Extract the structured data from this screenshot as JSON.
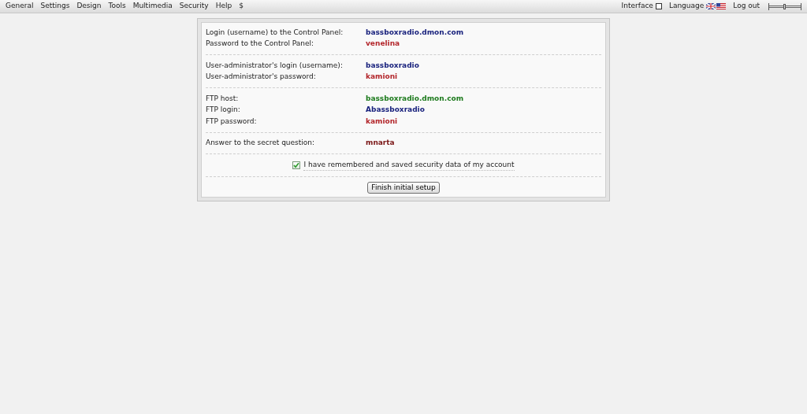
{
  "menu": [
    {
      "label": "General"
    },
    {
      "label": "Settings"
    },
    {
      "label": "Design"
    },
    {
      "label": "Tools"
    },
    {
      "label": "Multimedia"
    },
    {
      "label": "Security"
    },
    {
      "label": "Help"
    },
    {
      "label": "$"
    }
  ],
  "toolbar": {
    "interface": {
      "label": "Interface",
      "checked": false
    },
    "language": {
      "label": "Language"
    },
    "logout": {
      "label": "Log out"
    },
    "size_slider": {
      "level": 0.5
    }
  },
  "groups": [
    {
      "rows": [
        {
          "label": "Login (username) to the Control Panel:",
          "value": "bassboxradio.dmon.com",
          "color": "#1a237e"
        },
        {
          "label": "Password to the Control Panel:",
          "value": "venelina",
          "color": "#b3262b"
        }
      ]
    },
    {
      "rows": [
        {
          "label": "User-administrator's login (username):",
          "value": "bassboxradio",
          "color": "#1a237e"
        },
        {
          "label": "User-administrator's password:",
          "value": "kamioni",
          "color": "#b3262b"
        }
      ]
    },
    {
      "rows": [
        {
          "label": "FTP host:",
          "value": "bassboxradio.dmon.com",
          "color": "#1e7b1e"
        },
        {
          "label": "FTP login:",
          "value": "Abassboxradio",
          "color": "#1a237e"
        },
        {
          "label": "FTP password:",
          "value": "kamioni",
          "color": "#b3262b"
        }
      ]
    },
    {
      "rows": [
        {
          "label": "Answer to the secret question:",
          "value": "mnarta",
          "color": "#7a1515"
        }
      ]
    }
  ],
  "confirm": {
    "label": "I have remembered and saved security data of my account",
    "checked": true
  },
  "button": {
    "label": "Finish initial setup"
  }
}
